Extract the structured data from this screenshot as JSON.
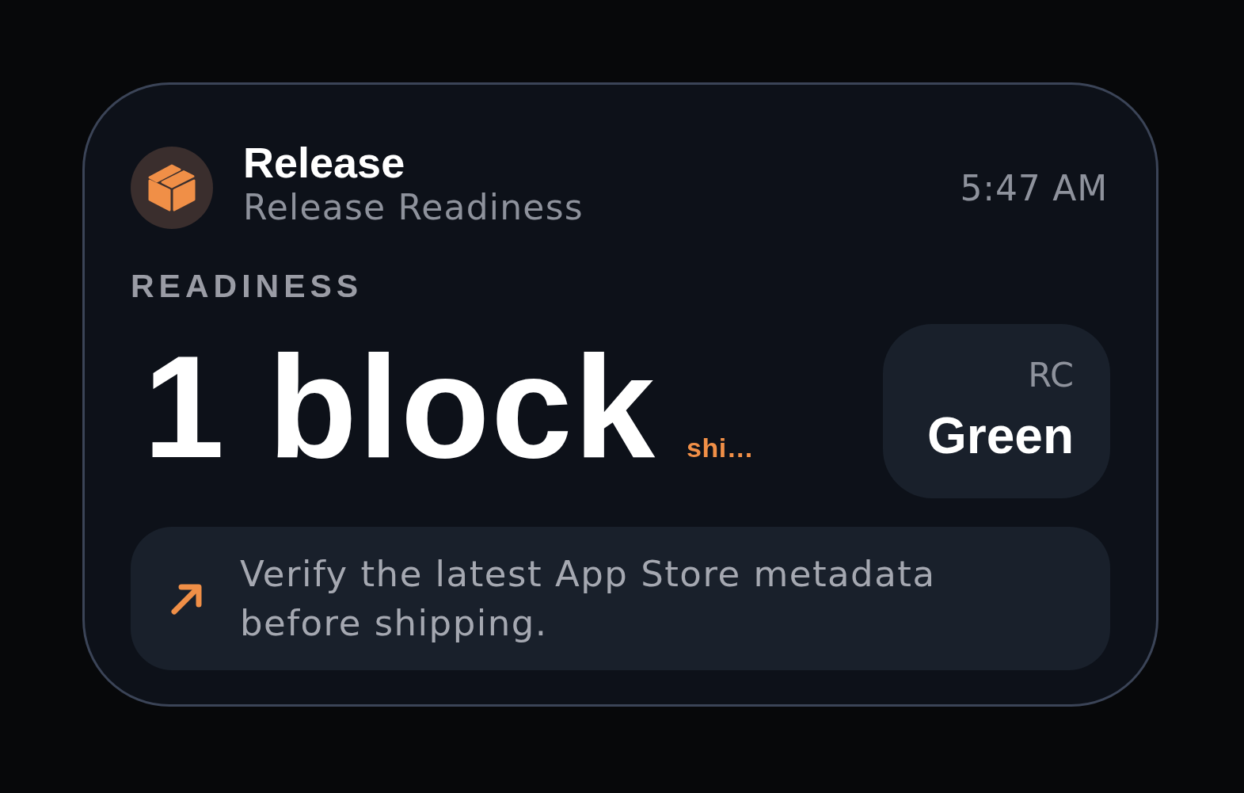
{
  "app": {
    "name": "Release",
    "subtitle": "Release Readiness",
    "time": "5:47 AM"
  },
  "metric": {
    "label": "READINESS",
    "value": "1 block",
    "note": "shi…"
  },
  "badge": {
    "label": "RC",
    "value": "Green"
  },
  "hint": {
    "text": "Verify the latest App Store metadata before shipping."
  }
}
